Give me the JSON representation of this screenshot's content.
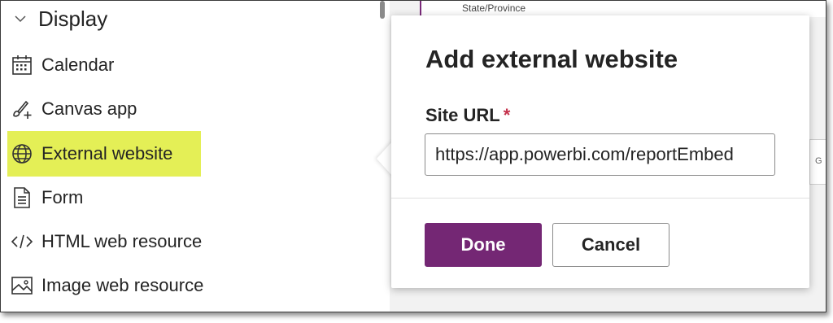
{
  "sidebar": {
    "section_title": "Display",
    "items": [
      {
        "label": "Calendar",
        "icon": "calendar-icon"
      },
      {
        "label": "Canvas app",
        "icon": "brush-add-icon"
      },
      {
        "label": "External website",
        "icon": "globe-icon",
        "selected": true
      },
      {
        "label": "Form",
        "icon": "form-icon"
      },
      {
        "label": "HTML web resource",
        "icon": "code-icon"
      },
      {
        "label": "Image web resource",
        "icon": "image-icon"
      }
    ]
  },
  "background": {
    "field_label": "State/Province",
    "strip_text": "G"
  },
  "dialog": {
    "title": "Add external website",
    "field_label": "Site URL",
    "required_mark": "*",
    "url_value": "https://app.powerbi.com/reportEmbed",
    "done_label": "Done",
    "cancel_label": "Cancel"
  },
  "colors": {
    "highlight": "#e4ef56",
    "primary_button": "#742774",
    "required": "#c4314b"
  }
}
